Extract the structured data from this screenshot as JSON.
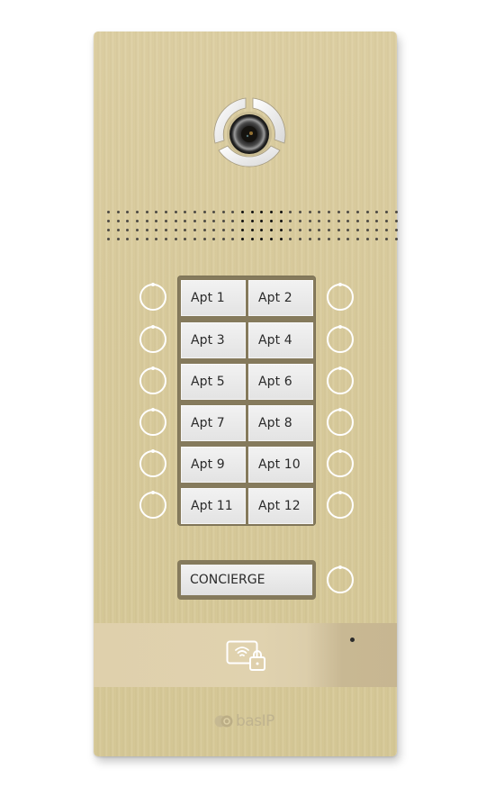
{
  "device": {
    "brand": "basIP",
    "finish_color": "#d9cb9c",
    "button_frame_color": "#857a5c",
    "label_color": "#e8e8e8"
  },
  "apartments": [
    {
      "label": "Apt 1"
    },
    {
      "label": "Apt 2"
    },
    {
      "label": "Apt 3"
    },
    {
      "label": "Apt 4"
    },
    {
      "label": "Apt 5"
    },
    {
      "label": "Apt 6"
    },
    {
      "label": "Apt 7"
    },
    {
      "label": "Apt 8"
    },
    {
      "label": "Apt 9"
    },
    {
      "label": "Apt 10"
    },
    {
      "label": "Apt 11"
    },
    {
      "label": "Apt 12"
    }
  ],
  "concierge": {
    "label": "CONCIERGE"
  },
  "reader": {
    "icon": "card-reader-wifi-lock-icon"
  },
  "icons": {
    "camera": "camera-lens-icon",
    "call_button": "ring-button-icon",
    "led": "status-led-icon",
    "logo": "basip-logo-icon"
  }
}
